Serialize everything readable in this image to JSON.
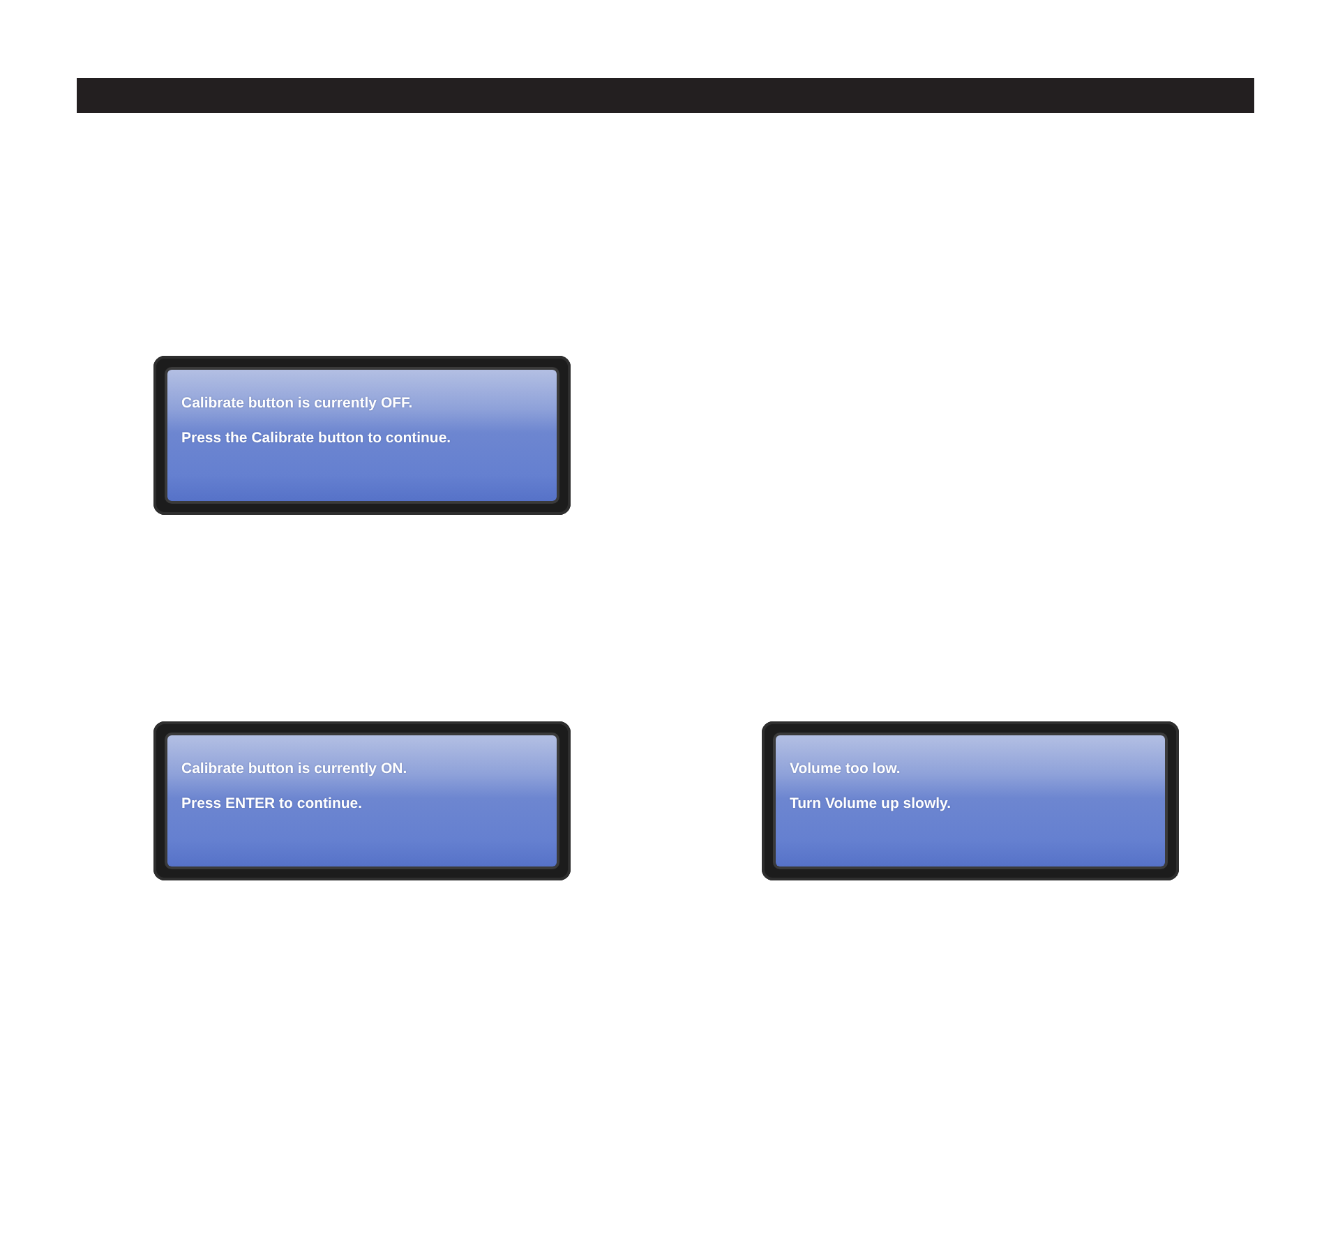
{
  "rows": [
    [
      {
        "lines": [
          "Calibrate button is currently OFF.",
          "Press the Calibrate button to continue."
        ]
      }
    ],
    [
      {
        "lines": [
          "Calibrate button is currently ON.",
          "Press ENTER to continue."
        ]
      },
      {
        "lines": [
          "Volume too low.",
          "Turn Volume up slowly."
        ]
      }
    ]
  ]
}
